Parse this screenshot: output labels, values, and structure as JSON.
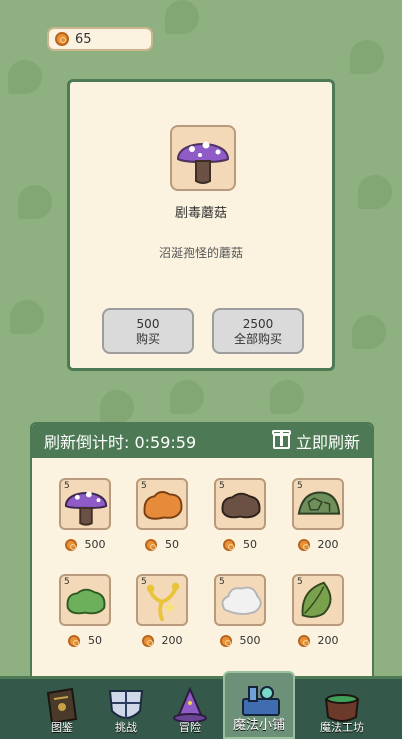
{
  "currency": {
    "amount": "65",
    "icon": "coin-icon"
  },
  "selected_item": {
    "name": "剧毒蘑菇",
    "description": "沼涎孢怪的蘑菇",
    "icon": "purple-mushroom-icon",
    "buy_one": {
      "price": "500",
      "label": "购买"
    },
    "buy_all": {
      "price": "2500",
      "label": "全部购买"
    }
  },
  "shop": {
    "refresh_countdown": "刷新倒计时: 0:59:59",
    "refresh_now_label": "立即刷新",
    "refresh_icon": "gift-icon",
    "items": [
      {
        "icon": "purple-mushroom-icon",
        "count": "5",
        "price": "500",
        "color": "#8e5bc7"
      },
      {
        "icon": "orange-slime-icon",
        "count": "5",
        "price": "50",
        "color": "#e58b3a"
      },
      {
        "icon": "brown-slime-icon",
        "count": "5",
        "price": "50",
        "color": "#6b5144"
      },
      {
        "icon": "turtle-shell-icon",
        "count": "5",
        "price": "200",
        "color": "#6f8f5a"
      },
      {
        "icon": "green-slime-icon",
        "count": "5",
        "price": "50",
        "color": "#6db05c"
      },
      {
        "icon": "yellow-sparkle-herb-icon",
        "count": "5",
        "price": "200",
        "color": "#e8c43a"
      },
      {
        "icon": "white-fluff-icon",
        "count": "5",
        "price": "500",
        "color": "#f1f1f1"
      },
      {
        "icon": "green-leaf-icon",
        "count": "5",
        "price": "200",
        "color": "#7aa24e"
      }
    ]
  },
  "nav": {
    "tabs": [
      {
        "label": "图鉴",
        "icon": "book-icon"
      },
      {
        "label": "挑战",
        "icon": "shield-icon"
      },
      {
        "label": "冒险",
        "icon": "wizard-hat-icon"
      },
      {
        "label": "魔法小铺",
        "icon": "magic-shop-icon",
        "active": true
      },
      {
        "label": "魔法工坊",
        "icon": "cauldron-icon"
      }
    ]
  }
}
